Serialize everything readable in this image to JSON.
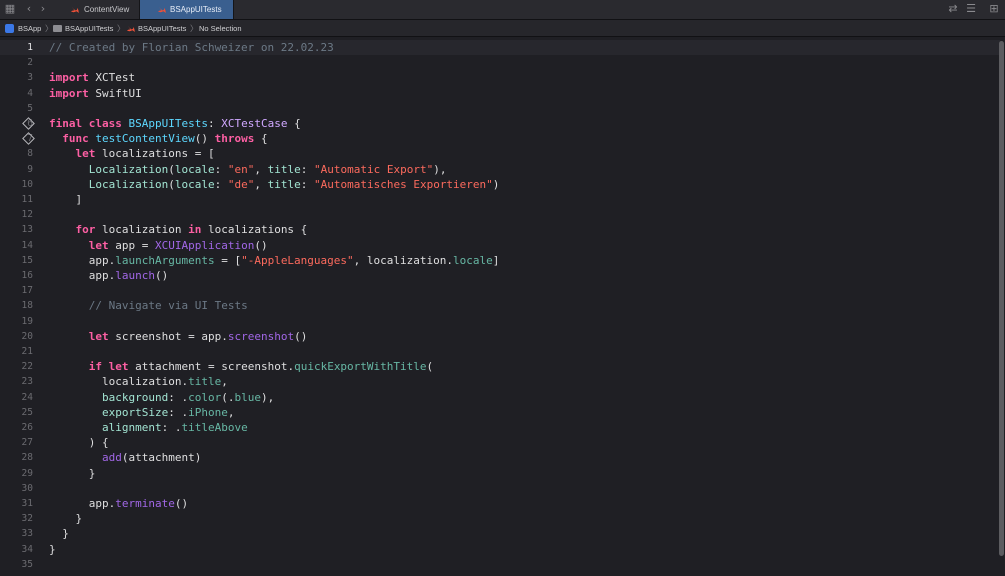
{
  "tabs": [
    {
      "label": "ContentView",
      "active": false
    },
    {
      "label": "BSAppUITests",
      "active": true
    }
  ],
  "breadcrumb": [
    "BSApp",
    "BSAppUITests",
    "BSAppUITests",
    "No Selection"
  ],
  "current_line": 1,
  "lines": [
    {
      "n": "1",
      "tokens": [
        [
          "cm",
          "// Created by Florian Schweizer on 22.02.23"
        ]
      ]
    },
    {
      "n": "2",
      "tokens": []
    },
    {
      "n": "3",
      "tokens": [
        [
          "kw",
          "import"
        ],
        [
          "pl",
          " XCTest"
        ]
      ]
    },
    {
      "n": "4",
      "tokens": [
        [
          "kw",
          "import"
        ],
        [
          "pl",
          " SwiftUI"
        ]
      ]
    },
    {
      "n": "5",
      "tokens": []
    },
    {
      "n": "6",
      "diamond": true,
      "tokens": [
        [
          "kw",
          "final class"
        ],
        [
          "pl",
          " "
        ],
        [
          "proj",
          "BSAppUITests"
        ],
        [
          "pl",
          ": "
        ],
        [
          "typ",
          "XCTestCase"
        ],
        [
          "pl",
          " {"
        ]
      ]
    },
    {
      "n": "7",
      "diamond": true,
      "tokens": [
        [
          "pl",
          "  "
        ],
        [
          "kw",
          "func"
        ],
        [
          "pl",
          " "
        ],
        [
          "proj",
          "testContentView"
        ],
        [
          "pl",
          "() "
        ],
        [
          "kw",
          "throws"
        ],
        [
          "pl",
          " {"
        ]
      ]
    },
    {
      "n": "8",
      "tokens": [
        [
          "pl",
          "    "
        ],
        [
          "kw",
          "let"
        ],
        [
          "pl",
          " localizations = ["
        ]
      ]
    },
    {
      "n": "9",
      "tokens": [
        [
          "pl",
          "      "
        ],
        [
          "lbl",
          "Localization"
        ],
        [
          "pl",
          "("
        ],
        [
          "lbl",
          "locale"
        ],
        [
          "pl",
          ": "
        ],
        [
          "str",
          "\"en\""
        ],
        [
          "pl",
          ", "
        ],
        [
          "lbl",
          "title"
        ],
        [
          "pl",
          ": "
        ],
        [
          "str",
          "\"Automatic Export\""
        ],
        [
          "pl",
          "),"
        ]
      ]
    },
    {
      "n": "10",
      "tokens": [
        [
          "pl",
          "      "
        ],
        [
          "lbl",
          "Localization"
        ],
        [
          "pl",
          "("
        ],
        [
          "lbl",
          "locale"
        ],
        [
          "pl",
          ": "
        ],
        [
          "str",
          "\"de\""
        ],
        [
          "pl",
          ", "
        ],
        [
          "lbl",
          "title"
        ],
        [
          "pl",
          ": "
        ],
        [
          "str",
          "\"Automatisches Exportieren\""
        ],
        [
          "pl",
          ")"
        ]
      ]
    },
    {
      "n": "11",
      "tokens": [
        [
          "pl",
          "    ]"
        ]
      ]
    },
    {
      "n": "12",
      "tokens": []
    },
    {
      "n": "13",
      "tokens": [
        [
          "pl",
          "    "
        ],
        [
          "kw",
          "for"
        ],
        [
          "pl",
          " localization "
        ],
        [
          "kw",
          "in"
        ],
        [
          "pl",
          " localizations {"
        ]
      ]
    },
    {
      "n": "14",
      "tokens": [
        [
          "pl",
          "      "
        ],
        [
          "kw",
          "let"
        ],
        [
          "pl",
          " app = "
        ],
        [
          "lib",
          "XCUIApplication"
        ],
        [
          "pl",
          "()"
        ]
      ]
    },
    {
      "n": "15",
      "tokens": [
        [
          "pl",
          "      app."
        ],
        [
          "prop",
          "launchArguments"
        ],
        [
          "pl",
          " = ["
        ],
        [
          "str",
          "\"-AppleLanguages\""
        ],
        [
          "pl",
          ", localization."
        ],
        [
          "prop",
          "locale"
        ],
        [
          "pl",
          "]"
        ]
      ]
    },
    {
      "n": "16",
      "tokens": [
        [
          "pl",
          "      app."
        ],
        [
          "fn",
          "launch"
        ],
        [
          "pl",
          "()"
        ]
      ]
    },
    {
      "n": "17",
      "tokens": []
    },
    {
      "n": "18",
      "tokens": [
        [
          "pl",
          "      "
        ],
        [
          "cm",
          "// Navigate via UI Tests"
        ]
      ]
    },
    {
      "n": "19",
      "tokens": []
    },
    {
      "n": "20",
      "tokens": [
        [
          "pl",
          "      "
        ],
        [
          "kw",
          "let"
        ],
        [
          "pl",
          " screenshot = app."
        ],
        [
          "fn",
          "screenshot"
        ],
        [
          "pl",
          "()"
        ]
      ]
    },
    {
      "n": "21",
      "tokens": []
    },
    {
      "n": "22",
      "tokens": [
        [
          "pl",
          "      "
        ],
        [
          "kw",
          "if let"
        ],
        [
          "pl",
          " attachment = screenshot."
        ],
        [
          "prop",
          "quickExportWithTitle"
        ],
        [
          "pl",
          "("
        ]
      ]
    },
    {
      "n": "23",
      "tokens": [
        [
          "pl",
          "        localization."
        ],
        [
          "prop",
          "title"
        ],
        [
          "pl",
          ","
        ]
      ]
    },
    {
      "n": "24",
      "tokens": [
        [
          "pl",
          "        "
        ],
        [
          "lbl",
          "background"
        ],
        [
          "pl",
          ": ."
        ],
        [
          "prop",
          "color"
        ],
        [
          "pl",
          "(."
        ],
        [
          "prop",
          "blue"
        ],
        [
          "pl",
          "),"
        ]
      ]
    },
    {
      "n": "25",
      "tokens": [
        [
          "pl",
          "        "
        ],
        [
          "lbl",
          "exportSize"
        ],
        [
          "pl",
          ": ."
        ],
        [
          "prop",
          "iPhone"
        ],
        [
          "pl",
          ","
        ]
      ]
    },
    {
      "n": "26",
      "tokens": [
        [
          "pl",
          "        "
        ],
        [
          "lbl",
          "alignment"
        ],
        [
          "pl",
          ": ."
        ],
        [
          "prop",
          "titleAbove"
        ]
      ]
    },
    {
      "n": "27",
      "tokens": [
        [
          "pl",
          "      ) {"
        ]
      ]
    },
    {
      "n": "28",
      "tokens": [
        [
          "pl",
          "        "
        ],
        [
          "fn",
          "add"
        ],
        [
          "pl",
          "(attachment)"
        ]
      ]
    },
    {
      "n": "29",
      "tokens": [
        [
          "pl",
          "      }"
        ]
      ]
    },
    {
      "n": "30",
      "tokens": []
    },
    {
      "n": "31",
      "tokens": [
        [
          "pl",
          "      app."
        ],
        [
          "fn",
          "terminate"
        ],
        [
          "pl",
          "()"
        ]
      ]
    },
    {
      "n": "32",
      "tokens": [
        [
          "pl",
          "    }"
        ]
      ]
    },
    {
      "n": "33",
      "tokens": [
        [
          "pl",
          "  }"
        ]
      ]
    },
    {
      "n": "34",
      "tokens": [
        [
          "pl",
          "}"
        ]
      ]
    },
    {
      "n": "35",
      "tokens": []
    }
  ]
}
